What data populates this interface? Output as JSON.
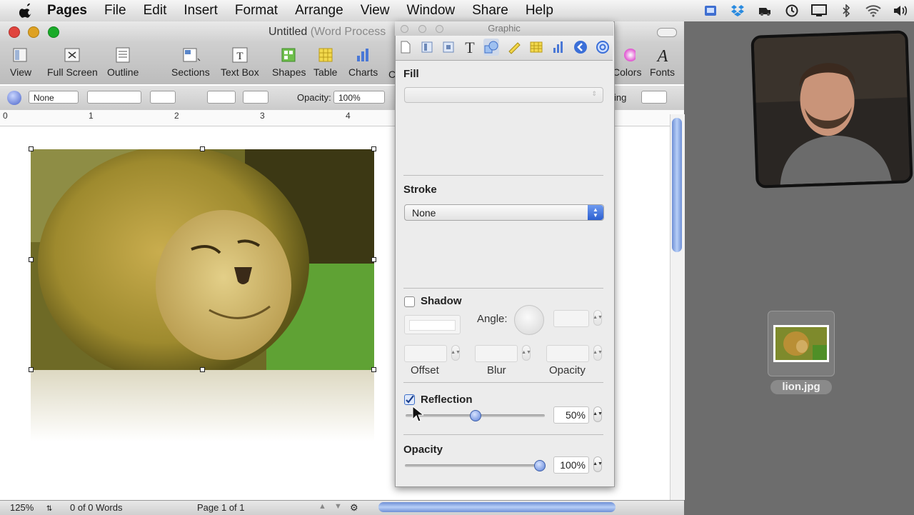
{
  "menubar": {
    "app_name": "Pages",
    "menus": [
      "File",
      "Edit",
      "Insert",
      "Format",
      "Arrange",
      "View",
      "Window",
      "Share",
      "Help"
    ],
    "status_icons": [
      "screen-sharing-icon",
      "dropbox-icon",
      "time-machine-icon",
      "history-icon",
      "display-icon",
      "bluetooth-icon",
      "wifi-icon",
      "volume-icon"
    ]
  },
  "window": {
    "title": "Untitled",
    "title_sub": "(Word Process",
    "toolbar": {
      "view": "View",
      "full_screen": "Full Screen",
      "outline": "Outline",
      "sections": "Sections",
      "text_box": "Text Box",
      "shapes": "Shapes",
      "table": "Table",
      "charts": "Charts",
      "comment_partial": "C",
      "colors": "Colors",
      "fonts": "Fonts"
    },
    "format_bar": {
      "style_value": "None",
      "opacity_label": "Opacity:",
      "opacity_value": "100%",
      "partial_label": "ing"
    },
    "ruler": [
      "0",
      "1",
      "2",
      "3",
      "4"
    ],
    "status": {
      "zoom": "125%",
      "word_count": "0 of 0 Words",
      "page": "Page 1 of 1"
    }
  },
  "inspector": {
    "title": "Graphic",
    "tabs": [
      "document-tab-icon",
      "layout-tab-icon",
      "wrap-tab-icon",
      "text-tab-icon",
      "graphic-tab-icon",
      "metrics-tab-icon",
      "table-tab-icon",
      "chart-tab-icon",
      "link-tab-icon",
      "quicktime-tab-icon"
    ],
    "fill": {
      "label": "Fill"
    },
    "stroke": {
      "label": "Stroke",
      "value": "None"
    },
    "shadow": {
      "label": "Shadow",
      "checked": false,
      "angle_label": "Angle:",
      "offset": "Offset",
      "blur": "Blur",
      "opacity": "Opacity"
    },
    "reflection": {
      "label": "Reflection",
      "checked": true,
      "value": "50%",
      "level": 0.5
    },
    "opacity": {
      "label": "Opacity",
      "value": "100%",
      "level": 1.0
    }
  },
  "desktop": {
    "file_label": "lion.jpg"
  },
  "colors": {
    "accent": "#4a78d6",
    "close": "#e0443e",
    "minimize": "#dea123",
    "zoom": "#1aab29"
  }
}
